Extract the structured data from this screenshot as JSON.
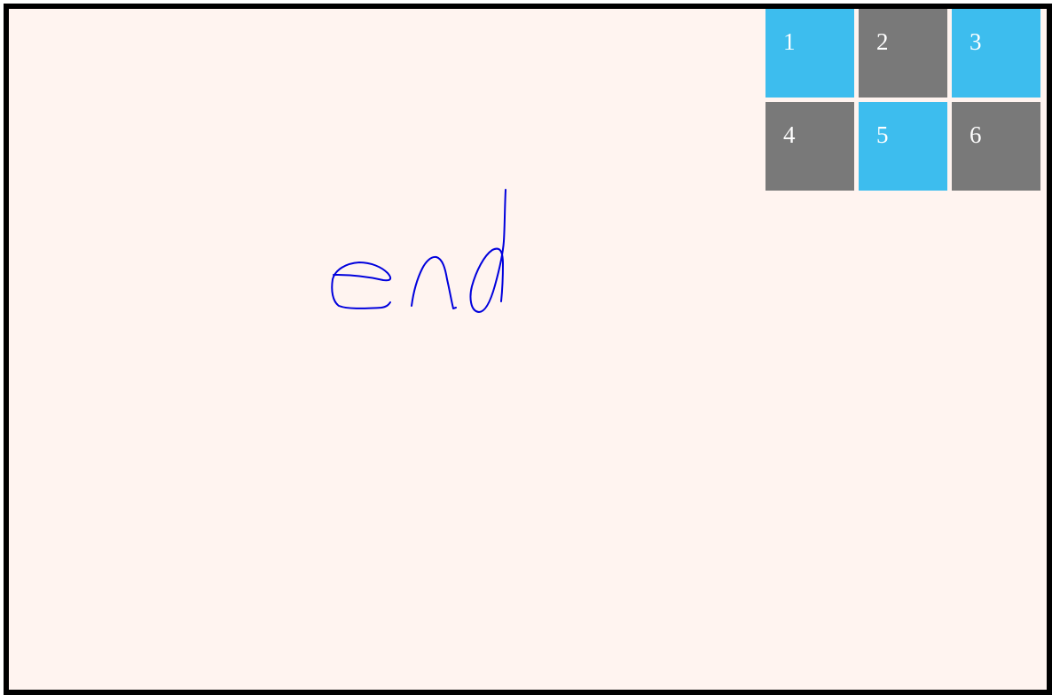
{
  "drawing": {
    "ink_color": "#0000dd",
    "background_color": "#fff4f0",
    "border_color": "#000000"
  },
  "tiles": [
    {
      "label": "1",
      "color": "#3dbdee"
    },
    {
      "label": "2",
      "color": "#797979"
    },
    {
      "label": "3",
      "color": "#3dbdee"
    },
    {
      "label": "4",
      "color": "#797979"
    },
    {
      "label": "5",
      "color": "#3dbdee"
    },
    {
      "label": "6",
      "color": "#797979"
    }
  ]
}
